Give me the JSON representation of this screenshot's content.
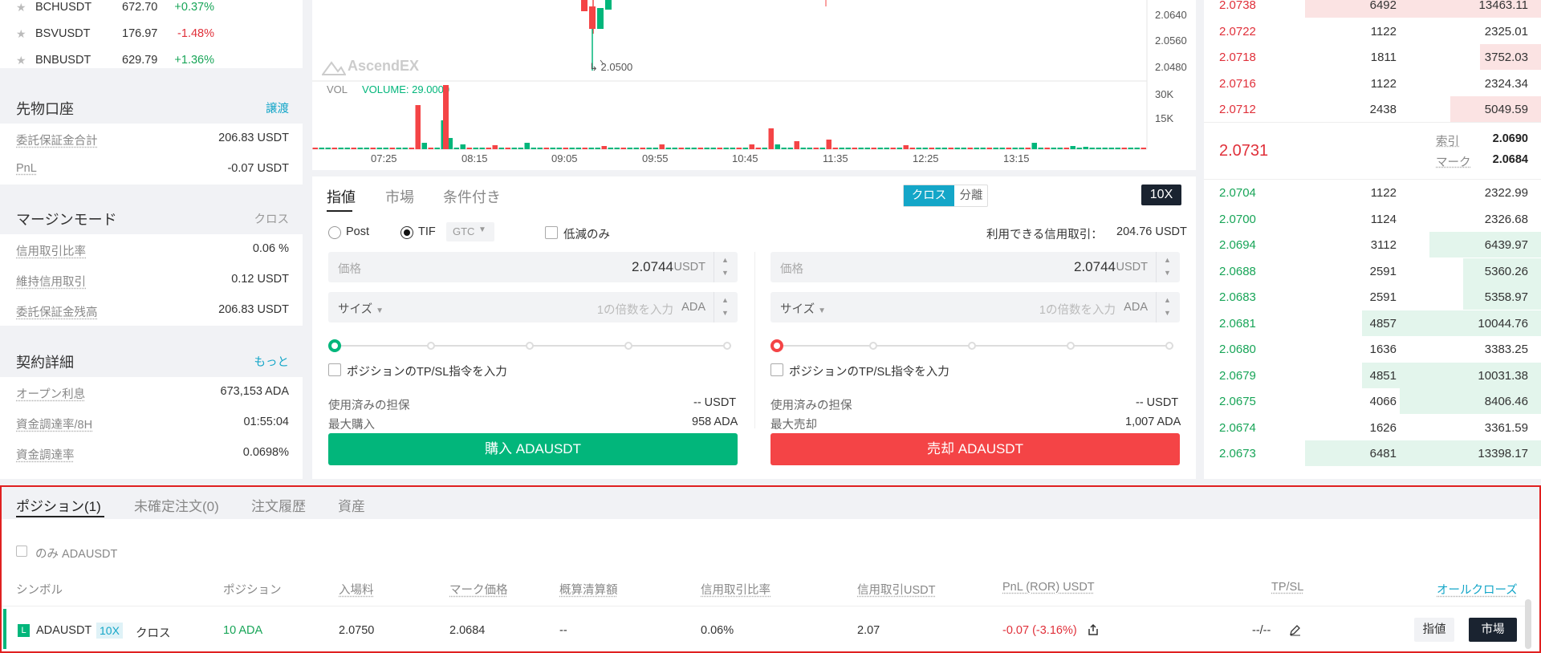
{
  "markets": [
    {
      "symbol": "BCHUSDT",
      "price": "672.70",
      "change": "+0.37%",
      "dir": "up"
    },
    {
      "symbol": "BSVUSDT",
      "price": "176.97",
      "change": "-1.48%",
      "dir": "dn"
    },
    {
      "symbol": "BNBUSDT",
      "price": "629.79",
      "change": "+1.36%",
      "dir": "up"
    }
  ],
  "futures_account": {
    "title": "先物口座",
    "link": "譲渡",
    "rows": [
      {
        "k": "委託保証金合計",
        "v": "206.83 USDT"
      },
      {
        "k": "PnL",
        "v": "-0.07 USDT"
      }
    ]
  },
  "margin_mode": {
    "title": "マージンモード",
    "value": "クロス",
    "rows": [
      {
        "k": "信用取引比率",
        "v": "0.06 %"
      },
      {
        "k": "維持信用取引",
        "v": "0.12 USDT"
      },
      {
        "k": "委託保証金残高",
        "v": "206.83 USDT"
      }
    ]
  },
  "contract": {
    "title": "契約詳細",
    "link": "もっと",
    "rows": [
      {
        "k": "オープン利息",
        "v": "673,153 ADA"
      },
      {
        "k": "資金調達率/8H",
        "v": "01:55:04"
      },
      {
        "k": "資金調達率",
        "v": "0.0698%"
      }
    ]
  },
  "chart": {
    "watermark": "AscendEX",
    "price_ticks": [
      "2.0640",
      "2.0560",
      "2.0480"
    ],
    "low_label": "2.0500",
    "vol_label": "VOL",
    "volume_text": "VOLUME: 29.0000",
    "vol_ticks": [
      "30K",
      "15K"
    ],
    "time_ticks": [
      "07:25",
      "08:15",
      "09:05",
      "09:55",
      "10:45",
      "11:35",
      "12:25",
      "13:15"
    ]
  },
  "order": {
    "tabs": [
      "指値",
      "市場",
      "条件付き"
    ],
    "mode": [
      "クロス",
      "分離"
    ],
    "leverage": "10X",
    "post": "Post",
    "tif": "TIF",
    "gtc": "GTC",
    "reduce": "低減のみ",
    "available_label": "利用できる信用取引：",
    "available_value": "204.76 USDT",
    "price_placeholder": "価格",
    "price_value": "2.0744",
    "price_unit": "USDT",
    "size_label": "サイズ",
    "size_placeholder": "1の倍数を入力",
    "size_unit": "ADA",
    "tpsl": "ポジションのTP/SL指令を入力",
    "used_label": "使用済みの担保",
    "used_value": "-- USDT",
    "max_buy_label": "最大購入",
    "max_buy_value": "958 ADA",
    "max_sell_label": "最大売却",
    "max_sell_value": "1,007 ADA",
    "buy_btn": "購入 ADAUSDT",
    "sell_btn": "売却 ADAUSDT"
  },
  "book": {
    "asks": [
      {
        "price": "2.0738",
        "qty": "6492",
        "total": "13463.11",
        "depth": 0.7
      },
      {
        "price": "2.0722",
        "qty": "1122",
        "total": "2325.01",
        "depth": 0.0
      },
      {
        "price": "2.0718",
        "qty": "1811",
        "total": "3752.03",
        "depth": 0.18
      },
      {
        "price": "2.0716",
        "qty": "1122",
        "total": "2324.34",
        "depth": 0.0
      },
      {
        "price": "2.0712",
        "qty": "2438",
        "total": "5049.59",
        "depth": 0.27
      }
    ],
    "last": "2.0731",
    "index_label": "索引",
    "index_value": "2.0690",
    "mark_label": "マーク",
    "mark_value": "2.0684",
    "bids": [
      {
        "price": "2.0704",
        "qty": "1122",
        "total": "2322.99",
        "depth": 0.0
      },
      {
        "price": "2.0700",
        "qty": "1124",
        "total": "2326.68",
        "depth": 0.0
      },
      {
        "price": "2.0694",
        "qty": "3112",
        "total": "6439.97",
        "depth": 0.33
      },
      {
        "price": "2.0688",
        "qty": "2591",
        "total": "5360.26",
        "depth": 0.23
      },
      {
        "price": "2.0683",
        "qty": "2591",
        "total": "5358.97",
        "depth": 0.23
      },
      {
        "price": "2.0681",
        "qty": "4857",
        "total": "10044.76",
        "depth": 0.53
      },
      {
        "price": "2.0680",
        "qty": "1636",
        "total": "3383.25",
        "depth": 0.0
      },
      {
        "price": "2.0679",
        "qty": "4851",
        "total": "10031.38",
        "depth": 0.53
      },
      {
        "price": "2.0675",
        "qty": "4066",
        "total": "8406.46",
        "depth": 0.42
      },
      {
        "price": "2.0674",
        "qty": "1626",
        "total": "3361.59",
        "depth": 0.0
      },
      {
        "price": "2.0673",
        "qty": "6481",
        "total": "13398.17",
        "depth": 0.7
      }
    ]
  },
  "positions": {
    "tabs": [
      "ポジション(1)",
      "未確定注文(0)",
      "注文履歴",
      "資産"
    ],
    "filter": "のみ ADAUSDT",
    "headers": [
      "シンボル",
      "ポジション",
      "入場料",
      "マーク価格",
      "概算清算額",
      "信用取引比率",
      "信用取引USDT",
      "PnL (ROR) USDT",
      "TP/SL"
    ],
    "close_all": "オールクローズ",
    "row": {
      "side": "L",
      "symbol": "ADAUSDT",
      "lev": "10X",
      "mode": "クロス",
      "position": "10 ADA",
      "entry": "2.0750",
      "mark": "2.0684",
      "liq": "--",
      "ratio": "0.06%",
      "margin": "2.07",
      "pnl": "-0.07 (-3.16%)",
      "tpsl": "--/--",
      "limit_btn": "指値",
      "market_btn": "市場"
    }
  },
  "colors": {
    "buy": "#02b67b",
    "sell": "#f44446",
    "accent": "#14a6c8"
  }
}
